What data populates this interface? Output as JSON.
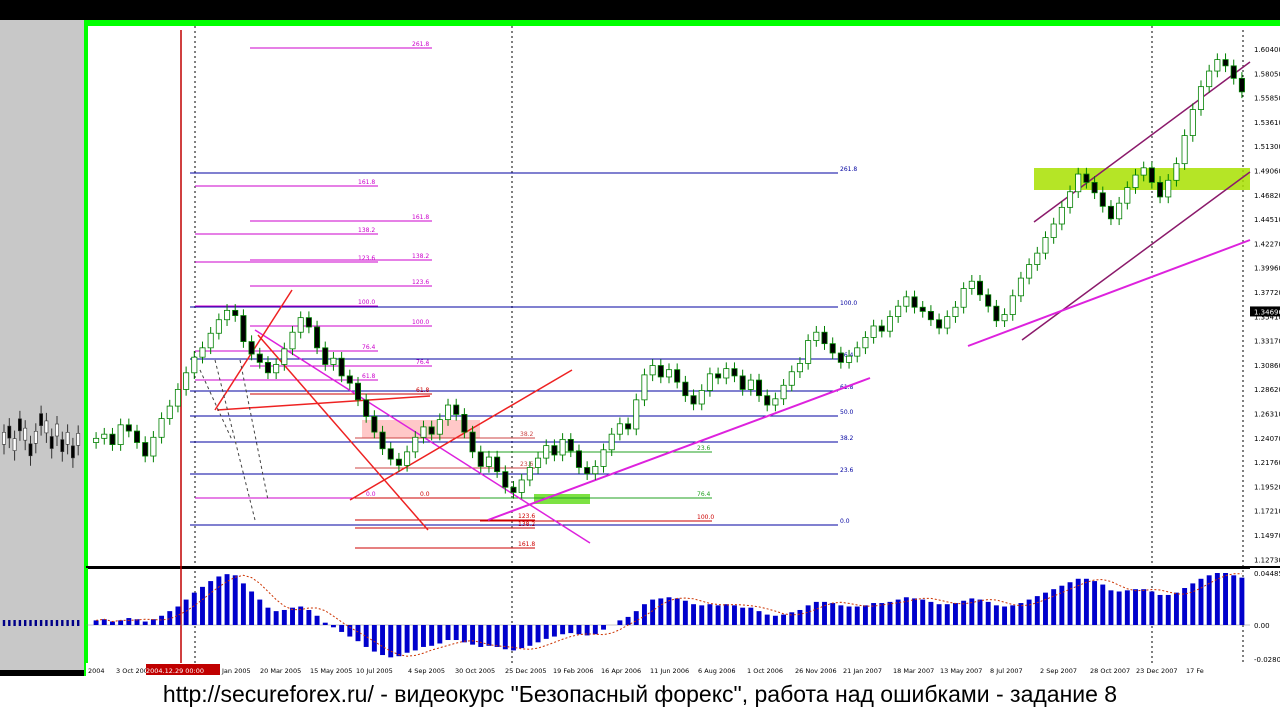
{
  "footer": {
    "text": "http://secureforex.ru/ - видеокурс \"Безопасный форекс\", работа над ошибками - задание 8"
  },
  "colors": {
    "chart_bg": "#ffffff",
    "frame_green": "#00ff00",
    "candle": "#008000",
    "macd_bar": "#0000cc",
    "fib_line": "#0000a0",
    "fib_magenta": "#cc00cc",
    "trend_red": "#ff0000",
    "highlight_lime": "#a8e000",
    "highlight_pink": "#ffb0b0"
  },
  "chart_data": {
    "type": "candlestick",
    "title": "",
    "price_axis": {
      "ticks": [
        "1.60400",
        "1.58050",
        "1.55850",
        "1.53610",
        "1.51300",
        "1.49060",
        "1.46820",
        "1.44510",
        "1.42270",
        "1.39960",
        "1.37720",
        "1.35410",
        "1.33170",
        "1.30860",
        "1.28620",
        "1.26310",
        "1.24070",
        "1.21760",
        "1.19520",
        "1.17210",
        "1.14970",
        "1.12730"
      ],
      "current_price": "1.34696",
      "ylim": [
        1.1273,
        1.604
      ]
    },
    "macd_axis": {
      "ticks": [
        "0.04485",
        "0.00",
        "-0.02803"
      ]
    },
    "date_axis": {
      "ticks": [
        "2004",
        "3 Oct 2004",
        "2004.12.29 00:00",
        "Jan 2005",
        "20 Mar 2005",
        "15 May 2005",
        "10 Jul 2005",
        "4 Sep 2005",
        "30 Oct 2005",
        "25 Dec 2005",
        "19 Feb 2006",
        "16 Apr 2006",
        "11 Jun 2006",
        "6 Aug 2006",
        "1 Oct 2006",
        "26 Nov 2006",
        "21 Jan 2007",
        "18 Mar 2007",
        "13 May 2007",
        "8 Jul 2007",
        "2 Sep 2007",
        "28 Oct 2007",
        "23 Dec 2007",
        "17 Fe"
      ]
    },
    "fib_labels": [
      "261.8",
      "161.8",
      "161.8",
      "161.8",
      "138.2",
      "123.6",
      "138.2",
      "123.6",
      "100.0",
      "100.0",
      "100.0",
      "76.4",
      "76.4",
      "76.4",
      "61.8",
      "61.8",
      "50.0",
      "50.0",
      "38.2",
      "38.2",
      "23.6",
      "23.6",
      "23.6",
      "0.0",
      "0.0",
      "0.0",
      "0.0",
      "100.0",
      "123.6",
      "138.2",
      "161.8"
    ],
    "series": [
      {
        "name": "",
        "values": [
          1.225,
          1.229,
          1.219,
          1.238,
          1.232,
          1.221,
          1.208,
          1.226,
          1.244,
          1.256,
          1.272,
          1.288,
          1.303,
          1.312,
          1.326,
          1.339,
          1.348,
          1.343,
          1.318,
          1.306,
          1.298,
          1.288,
          1.296,
          1.311,
          1.327,
          1.341,
          1.332,
          1.312,
          1.296,
          1.302,
          1.285,
          1.278,
          1.262,
          1.246,
          1.231,
          1.215,
          1.205,
          1.199,
          1.212,
          1.226,
          1.236,
          1.229,
          1.243,
          1.257,
          1.248,
          1.231,
          1.212,
          1.198,
          1.207,
          1.193,
          1.178,
          1.173,
          1.185,
          1.197,
          1.206,
          1.218,
          1.209,
          1.224,
          1.213,
          1.197,
          1.191,
          1.198,
          1.214,
          1.229,
          1.239,
          1.234,
          1.262,
          1.286,
          1.295,
          1.284,
          1.291,
          1.279,
          1.266,
          1.258,
          1.271,
          1.287,
          1.283,
          1.292,
          1.285,
          1.272,
          1.281,
          1.266,
          1.257,
          1.263,
          1.276,
          1.289,
          1.297,
          1.319,
          1.327,
          1.316,
          1.307,
          1.298,
          1.304,
          1.312,
          1.322,
          1.333,
          1.328,
          1.342,
          1.352,
          1.361,
          1.351,
          1.347,
          1.339,
          1.331,
          1.342,
          1.351,
          1.369,
          1.376,
          1.363,
          1.352,
          1.338,
          1.344,
          1.362,
          1.379,
          1.392,
          1.403,
          1.418,
          1.431,
          1.447,
          1.462,
          1.479,
          1.471,
          1.461,
          1.448,
          1.436,
          1.451,
          1.466,
          1.478,
          1.485,
          1.471,
          1.457,
          1.473,
          1.489,
          1.516,
          1.541,
          1.563,
          1.578,
          1.589,
          1.583,
          1.571,
          1.558
        ]
      }
    ],
    "macd": [
      0.004,
      0.005,
      0.003,
      0.004,
      0.006,
      0.005,
      0.003,
      0.005,
      0.008,
      0.012,
      0.016,
      0.022,
      0.028,
      0.033,
      0.038,
      0.042,
      0.044,
      0.043,
      0.036,
      0.029,
      0.022,
      0.015,
      0.012,
      0.013,
      0.015,
      0.016,
      0.013,
      0.008,
      0.002,
      -0.002,
      -0.006,
      -0.01,
      -0.014,
      -0.019,
      -0.023,
      -0.026,
      -0.028,
      -0.027,
      -0.024,
      -0.022,
      -0.019,
      -0.018,
      -0.016,
      -0.013,
      -0.013,
      -0.015,
      -0.017,
      -0.019,
      -0.018,
      -0.019,
      -0.021,
      -0.022,
      -0.02,
      -0.018,
      -0.015,
      -0.012,
      -0.01,
      -0.008,
      -0.007,
      -0.008,
      -0.009,
      -0.008,
      -0.004,
      0.0,
      0.004,
      0.007,
      0.012,
      0.018,
      0.022,
      0.023,
      0.024,
      0.023,
      0.021,
      0.018,
      0.017,
      0.018,
      0.017,
      0.018,
      0.017,
      0.015,
      0.015,
      0.012,
      0.009,
      0.008,
      0.009,
      0.011,
      0.013,
      0.017,
      0.02,
      0.02,
      0.019,
      0.017,
      0.016,
      0.016,
      0.017,
      0.019,
      0.019,
      0.02,
      0.022,
      0.024,
      0.023,
      0.022,
      0.02,
      0.018,
      0.018,
      0.019,
      0.021,
      0.023,
      0.022,
      0.02,
      0.017,
      0.016,
      0.017,
      0.019,
      0.022,
      0.025,
      0.028,
      0.031,
      0.034,
      0.037,
      0.04,
      0.04,
      0.038,
      0.035,
      0.03,
      0.029,
      0.03,
      0.031,
      0.031,
      0.029,
      0.026,
      0.026,
      0.028,
      0.032,
      0.036,
      0.04,
      0.043,
      0.045,
      0.045,
      0.043,
      0.041
    ]
  }
}
